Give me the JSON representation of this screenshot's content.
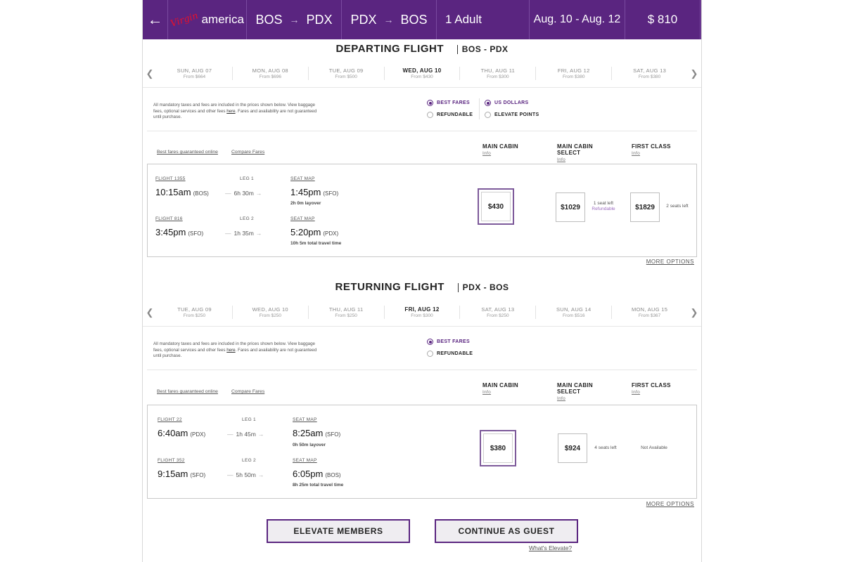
{
  "header": {
    "back_icon": "←",
    "logo_script": "Virgin",
    "logo_word": "america",
    "outbound": {
      "from": "BOS",
      "arrow": "→",
      "to": "PDX"
    },
    "inbound": {
      "from": "PDX",
      "arrow": "→",
      "to": "BOS"
    },
    "passengers": "1 Adult",
    "dates": "Aug. 10 - Aug. 12",
    "total_price": "$ 810"
  },
  "colors": {
    "brand": "#5a2580",
    "accent_red": "#e8102a",
    "refundable": "#9b6bbf"
  },
  "icons": {
    "prev": "chevron-left-icon",
    "next": "chevron-right-icon",
    "back": "arrow-left-icon"
  },
  "departing": {
    "title": "DEPARTING FLIGHT",
    "pair": "BOS - PDX",
    "days": [
      {
        "day": "SUN, AUG 07",
        "from": "From $664"
      },
      {
        "day": "MON, AUG 08",
        "from": "From $696"
      },
      {
        "day": "TUE, AUG 09",
        "from": "From $500"
      },
      {
        "day": "WED, AUG 10",
        "from": "From $430",
        "selected": true
      },
      {
        "day": "THU, AUG 11",
        "from": "From $300"
      },
      {
        "day": "FRI, AUG 12",
        "from": "From $380"
      },
      {
        "day": "SAT, AUG 13",
        "from": "From $380"
      }
    ],
    "notice_pre": "All mandatory taxes and fees are included in the prices shown below. View baggage fees, optional services and other fees ",
    "notice_link": "here",
    "notice_post": ". Fares and availability are not guaranteed until purchase.",
    "options": {
      "best_fares": "BEST FARES",
      "refundable": "REFUNDABLE",
      "us_dollars": "US DOLLARS",
      "elevate_points": "ELEVATE POINTS"
    },
    "links": {
      "guaranteed": "Best fares guaranteed online",
      "compare": "Compare Fares"
    },
    "cabins": {
      "main": "MAIN CABIN",
      "select_1": "MAIN CABIN",
      "select_2": "SELECT",
      "first": "FIRST CLASS",
      "info": "Info"
    },
    "leg1": {
      "flight": "FLIGHT 1355",
      "leg": "LEG 1",
      "dep_time": "10:15am",
      "dep_ap": "(BOS)",
      "duration": "6h 30m",
      "seat_map": "SEAT MAP",
      "arr_time": "1:45pm",
      "arr_ap": "(SFO)",
      "sub": "2h 0m layover"
    },
    "leg2": {
      "flight": "FLIGHT 816",
      "leg": "LEG 2",
      "dep_time": "3:45pm",
      "dep_ap": "(SFO)",
      "duration": "1h 35m",
      "seat_map": "SEAT MAP",
      "arr_time": "5:20pm",
      "arr_ap": "(PDX)",
      "sub": "10h 5m total travel time"
    },
    "fares": {
      "main": "$430",
      "select": "$1029",
      "select_note": "1 seat left",
      "select_refund": "Refundable",
      "first": "$1829",
      "first_note": "2 seats left"
    },
    "more": "MORE OPTIONS"
  },
  "returning": {
    "title": "RETURNING FLIGHT",
    "pair": "PDX - BOS",
    "days": [
      {
        "day": "TUE, AUG 09",
        "from": "From $250"
      },
      {
        "day": "WED, AUG 10",
        "from": "From $250"
      },
      {
        "day": "THU, AUG 11",
        "from": "From $250"
      },
      {
        "day": "FRI, AUG 12",
        "from": "From $300",
        "selected": true
      },
      {
        "day": "SAT, AUG 13",
        "from": "From $250"
      },
      {
        "day": "SUN, AUG 14",
        "from": "From $516"
      },
      {
        "day": "MON, AUG 15",
        "from": "From $367"
      }
    ],
    "notice_pre": "All mandatory taxes and fees are included in the prices shown below. View baggage fees, optional services and other fees ",
    "notice_link": "here",
    "notice_post": ". Fares and availability are not guaranteed until purchase.",
    "options": {
      "best_fares": "BEST FARES",
      "refundable": "REFUNDABLE"
    },
    "links": {
      "guaranteed": "Best fares guaranteed online",
      "compare": "Compare Fares"
    },
    "cabins": {
      "main": "MAIN CABIN",
      "select_1": "MAIN CABIN",
      "select_2": "SELECT",
      "first": "FIRST CLASS",
      "info": "Info"
    },
    "leg1": {
      "flight": "FLIGHT 22",
      "leg": "LEG 1",
      "dep_time": "6:40am",
      "dep_ap": "(PDX)",
      "duration": "1h 45m",
      "seat_map": "SEAT MAP",
      "arr_time": "8:25am",
      "arr_ap": "(SFO)",
      "sub": "0h 50m layover"
    },
    "leg2": {
      "flight": "FLIGHT 352",
      "leg": "LEG 2",
      "dep_time": "9:15am",
      "dep_ap": "(SFO)",
      "duration": "5h 50m",
      "seat_map": "SEAT MAP",
      "arr_time": "6:05pm",
      "arr_ap": "(BOS)",
      "sub": "8h 25m total travel time"
    },
    "fares": {
      "main": "$380",
      "select": "$924",
      "select_note": "4 seats left",
      "first_note": "Not Available"
    },
    "more": "MORE OPTIONS"
  },
  "footer": {
    "elevate": "ELEVATE MEMBERS",
    "guest": "CONTINUE AS GUEST",
    "whats_elevate": "What's Elevate?"
  }
}
